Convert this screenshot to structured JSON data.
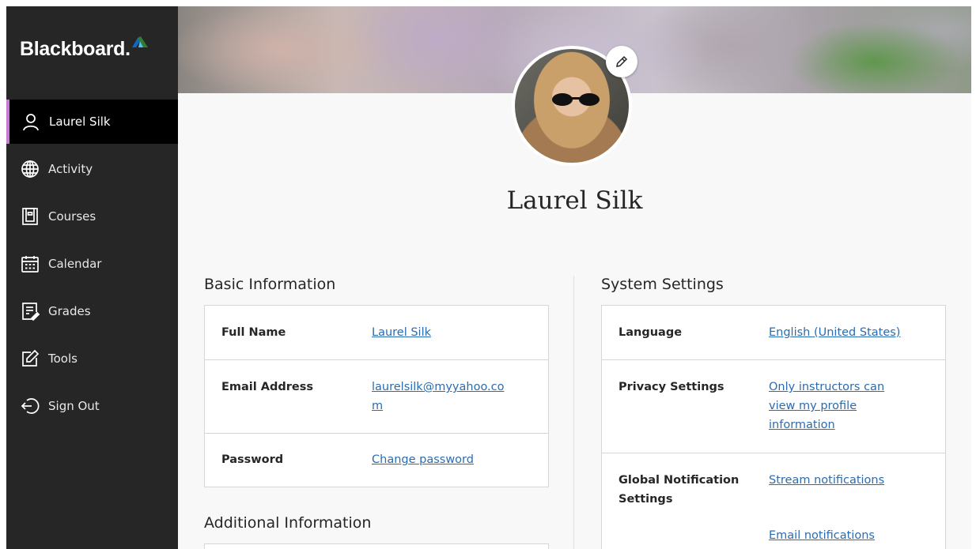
{
  "sidebar": {
    "logo_text": "Blackboard",
    "items": [
      {
        "label": "Laurel Silk",
        "icon": "user-icon",
        "active": true
      },
      {
        "label": "Activity",
        "icon": "globe-icon"
      },
      {
        "label": "Courses",
        "icon": "book-icon"
      },
      {
        "label": "Calendar",
        "icon": "calendar-icon"
      },
      {
        "label": "Grades",
        "icon": "grades-icon"
      },
      {
        "label": "Tools",
        "icon": "tools-icon"
      },
      {
        "label": "Sign Out",
        "icon": "sign-out-icon"
      }
    ]
  },
  "profile": {
    "name": "Laurel Silk"
  },
  "basic": {
    "title": "Basic Information",
    "rows": [
      {
        "label": "Full Name",
        "value_lines": [
          "Laurel Silk"
        ]
      },
      {
        "label": "Email Address",
        "value_lines": [
          "laurelsilk@myyahoo.co",
          "m"
        ]
      },
      {
        "label": "Password",
        "value_lines": [
          "Change password"
        ]
      }
    ]
  },
  "additional": {
    "title": "Additional Information"
  },
  "system": {
    "title": "System Settings",
    "rows": [
      {
        "label_lines": [
          "Language"
        ],
        "value_lines": [
          "English (United States)"
        ]
      },
      {
        "label_lines": [
          "Privacy Settings"
        ],
        "value_lines": [
          "Only instructors can",
          "view my profile",
          "information"
        ]
      },
      {
        "label_lines": [
          "Global Notification",
          "Settings"
        ],
        "value_lines": [
          "Stream notifications"
        ],
        "value2_lines": [
          "Email notifications"
        ]
      }
    ]
  },
  "colors": {
    "sidebar_bg": "#262626",
    "active_accent": "#c57ad6",
    "link": "#2b6cb0"
  }
}
